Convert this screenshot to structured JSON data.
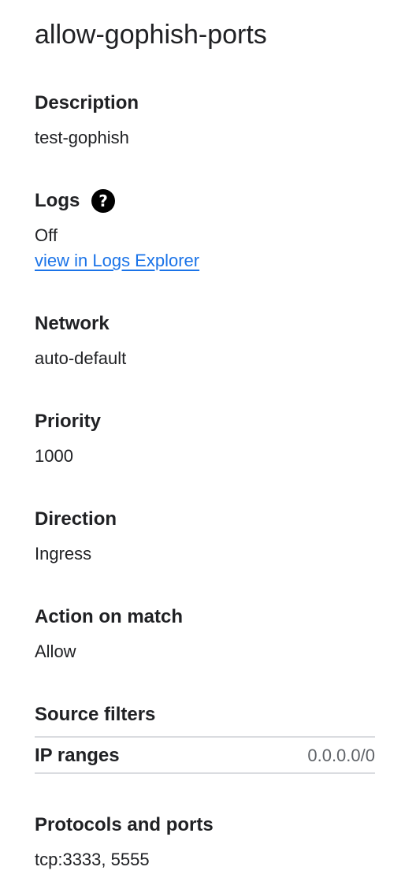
{
  "title": "allow-gophish-ports",
  "description": {
    "label": "Description",
    "value": "test-gophish"
  },
  "logs": {
    "label": "Logs",
    "help_icon": "?",
    "value": "Off",
    "link": "view in Logs Explorer"
  },
  "network": {
    "label": "Network",
    "value": "auto-default"
  },
  "priority": {
    "label": "Priority",
    "value": "1000"
  },
  "direction": {
    "label": "Direction",
    "value": "Ingress"
  },
  "action": {
    "label": "Action on match",
    "value": "Allow"
  },
  "source_filters": {
    "label": "Source filters",
    "ip_ranges_label": "IP ranges",
    "ip_ranges_value": "0.0.0.0/0"
  },
  "protocols": {
    "label": "Protocols and ports",
    "value": "tcp:3333, 5555"
  },
  "colors": {
    "link": "#1a73e8",
    "text": "#202124",
    "muted": "#5f6368",
    "divider": "#dadce0"
  }
}
